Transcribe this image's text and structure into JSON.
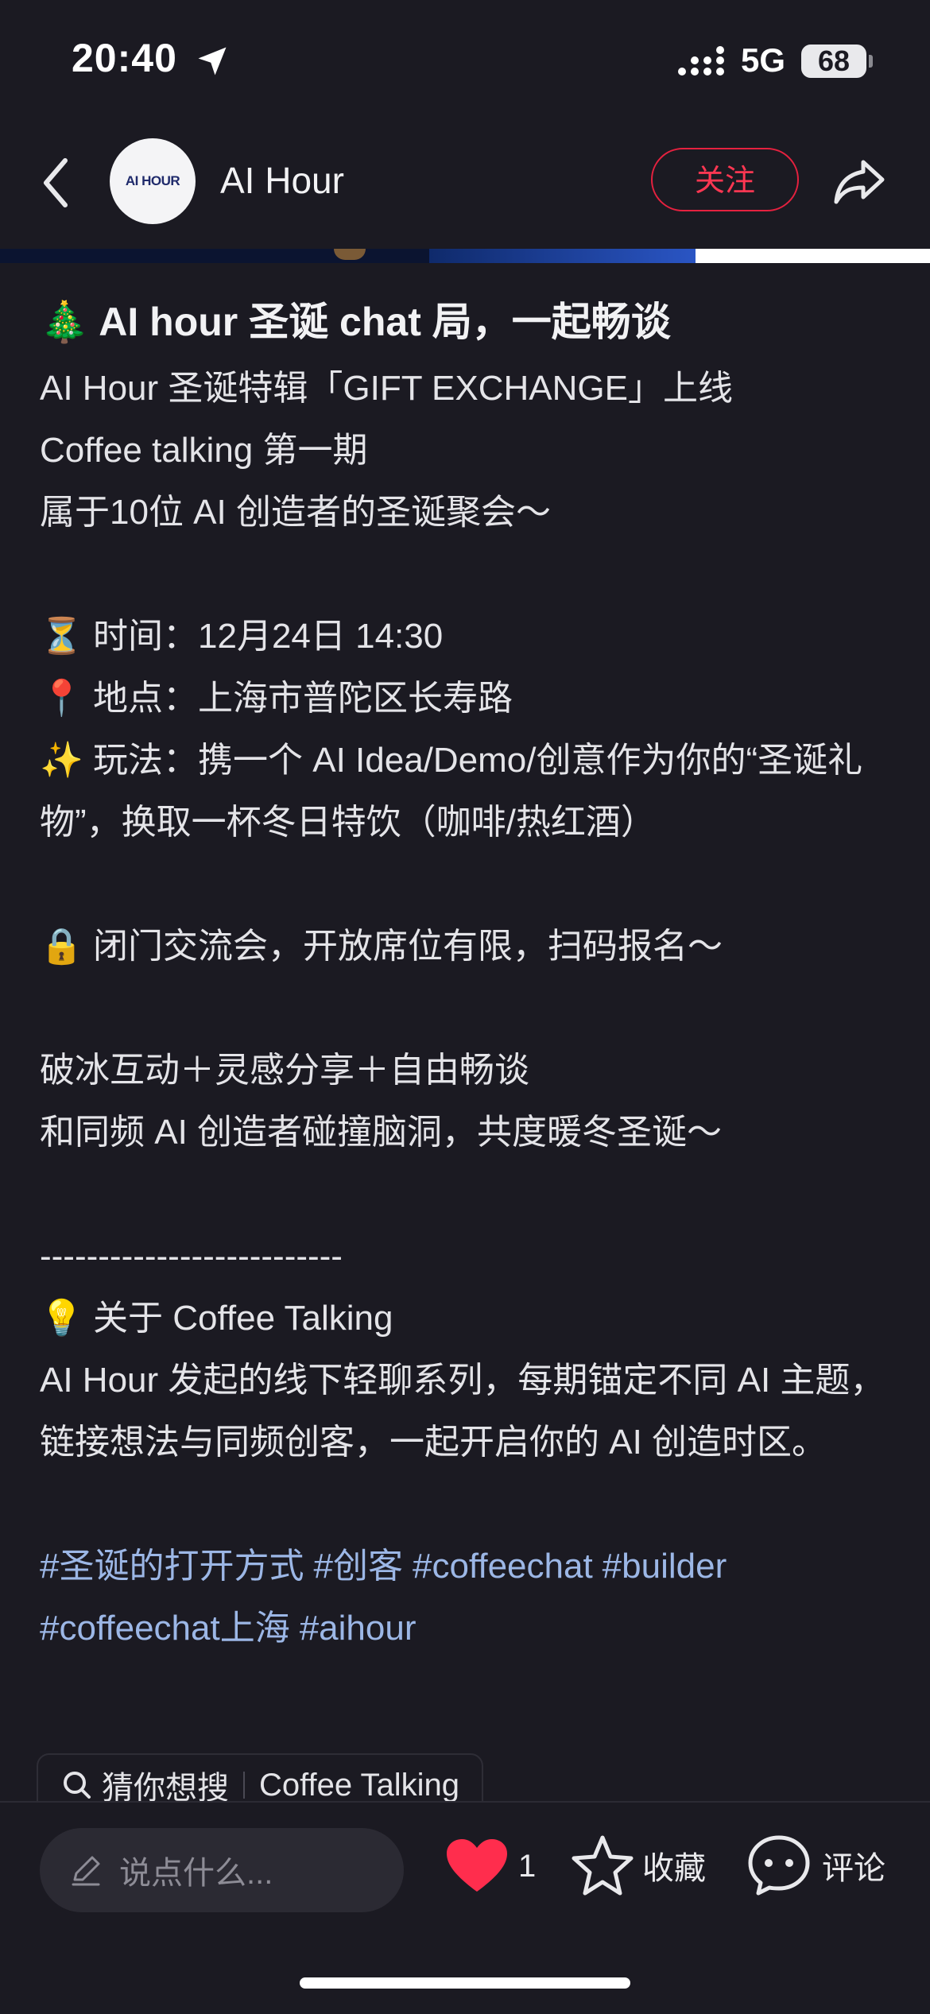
{
  "status_bar": {
    "time": "20:40",
    "network": "5G",
    "battery": "68"
  },
  "header": {
    "avatar_text": "AI HOUR",
    "author": "AI Hour",
    "follow_label": "关注"
  },
  "post": {
    "title": "🎄 AI hour 圣诞 chat 局，一起畅谈",
    "lines": {
      "l1": "AI Hour 圣诞特辑「GIFT EXCHANGE」上线",
      "l2": "Coffee talking 第一期",
      "l3": "属于10位 AI 创造者的圣诞聚会～",
      "l4": "⏳ 时间：12月24日 14:30",
      "l5": "📍 地点：上海市普陀区长寿路",
      "l6": "✨ 玩法：携一个 AI Idea/Demo/创意作为你的“圣诞礼物”，换取一杯冬日特饮（咖啡/热红酒）",
      "l7": "🔒 闭门交流会，开放席位有限，扫码报名～",
      "l8": "破冰互动＋灵感分享＋自由畅谈",
      "l9": "和同频 AI 创造者碰撞脑洞，共度暖冬圣诞～",
      "l10": "--------------------------",
      "l11": "💡 关于 Coffee Talking",
      "l12": "AI Hour 发起的线下轻聊系列，每期锚定不同 AI 主题，链接想法与同频创客，一起开启你的 AI 创造时区。"
    },
    "tags": [
      "#圣诞的打开方式",
      "#创客",
      "#coffeechat",
      "#builder",
      "#coffeechat上海",
      "#aihour"
    ]
  },
  "suggest": {
    "label": "猜你想搜",
    "query": "Coffee Talking"
  },
  "bottom_bar": {
    "comment_placeholder": "说点什么...",
    "like_count": "1",
    "favorite_label": "收藏",
    "comment_label": "评论"
  },
  "colors": {
    "background": "#1b1a22",
    "accent_red": "#ff3752",
    "tag_blue": "#9cb7e6"
  }
}
